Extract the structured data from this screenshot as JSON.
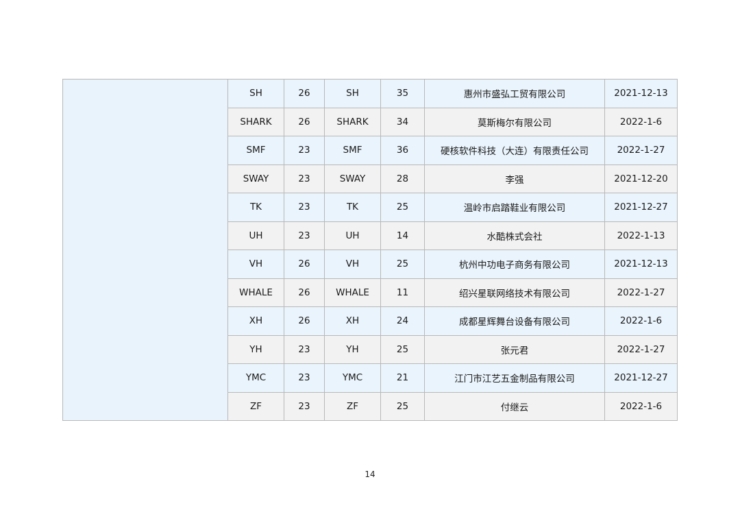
{
  "table": {
    "rows": [
      {
        "mark": "SH",
        "class_a": "26",
        "mark_b": "SH",
        "class_b": "35",
        "applicant": "惠州市盛弘工贸有限公司",
        "date": "2021-12-13"
      },
      {
        "mark": "SHARK",
        "class_a": "26",
        "mark_b": "SHARK",
        "class_b": "34",
        "applicant": "莫斯梅尔有限公司",
        "date": "2022-1-6"
      },
      {
        "mark": "SMF",
        "class_a": "23",
        "mark_b": "SMF",
        "class_b": "36",
        "applicant": "硬核软件科技（大连）有限责任公司",
        "date": "2022-1-27"
      },
      {
        "mark": "SWAY",
        "class_a": "23",
        "mark_b": "SWAY",
        "class_b": "28",
        "applicant": "李强",
        "date": "2021-12-20"
      },
      {
        "mark": "TK",
        "class_a": "23",
        "mark_b": "TK",
        "class_b": "25",
        "applicant": "温岭市启踏鞋业有限公司",
        "date": "2021-12-27"
      },
      {
        "mark": "UH",
        "class_a": "23",
        "mark_b": "UH",
        "class_b": "14",
        "applicant": "水酷株式会社",
        "date": "2022-1-13"
      },
      {
        "mark": "VH",
        "class_a": "26",
        "mark_b": "VH",
        "class_b": "25",
        "applicant": "杭州中功电子商务有限公司",
        "date": "2021-12-13"
      },
      {
        "mark": "WHALE",
        "class_a": "26",
        "mark_b": "WHALE",
        "class_b": "11",
        "applicant": "绍兴星联网络技术有限公司",
        "date": "2022-1-27"
      },
      {
        "mark": "XH",
        "class_a": "26",
        "mark_b": "XH",
        "class_b": "24",
        "applicant": "成都星辉舞台设备有限公司",
        "date": "2022-1-6"
      },
      {
        "mark": "YH",
        "class_a": "23",
        "mark_b": "YH",
        "class_b": "25",
        "applicant": "张元君",
        "date": "2022-1-27"
      },
      {
        "mark": "YMC",
        "class_a": "23",
        "mark_b": "YMC",
        "class_b": "21",
        "applicant": "江门市江艺五金制品有限公司",
        "date": "2021-12-27"
      },
      {
        "mark": "ZF",
        "class_a": "23",
        "mark_b": "ZF",
        "class_b": "25",
        "applicant": "付继云",
        "date": "2022-1-6"
      }
    ]
  },
  "page_number": "14",
  "colors": {
    "row_blue": "#eaf4fc",
    "row_gray": "#f2f2f2",
    "group_cell": "#e8f3fb",
    "border": "#b8b8b8"
  }
}
